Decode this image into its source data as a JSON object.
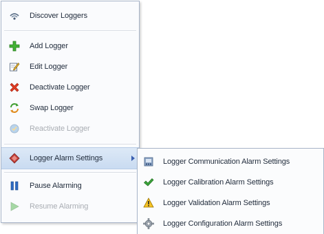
{
  "menu": {
    "items": [
      {
        "label": "Discover Loggers",
        "icon": "discover-icon",
        "enabled": true
      },
      {
        "label": "Add Logger",
        "icon": "plus-icon",
        "enabled": true
      },
      {
        "label": "Edit Logger",
        "icon": "edit-icon",
        "enabled": true
      },
      {
        "label": "Deactivate Logger",
        "icon": "x-icon",
        "enabled": true
      },
      {
        "label": "Swap Logger",
        "icon": "swap-icon",
        "enabled": true
      },
      {
        "label": "Reactivate Logger",
        "icon": "reactivate-icon",
        "enabled": false
      },
      {
        "label": "Logger Alarm Settings",
        "icon": "alarm-diamond-icon",
        "enabled": true,
        "has_submenu": true
      },
      {
        "label": "Pause Alarming",
        "icon": "pause-icon",
        "enabled": true
      },
      {
        "label": "Resume Alarming",
        "icon": "play-icon",
        "enabled": false
      }
    ]
  },
  "submenu": {
    "items": [
      {
        "label": "Logger Communication Alarm Settings",
        "icon": "communication-icon"
      },
      {
        "label": "Logger Calibration Alarm Settings",
        "icon": "checkmark-icon"
      },
      {
        "label": "Logger Validation Alarm Settings",
        "icon": "warning-icon"
      },
      {
        "label": "Logger Configuration Alarm Settings",
        "icon": "gear-icon"
      }
    ]
  },
  "colors": {
    "hover_bg": "#cfe0f3",
    "disabled_text": "#a9adb3",
    "text": "#1f2a3a"
  }
}
